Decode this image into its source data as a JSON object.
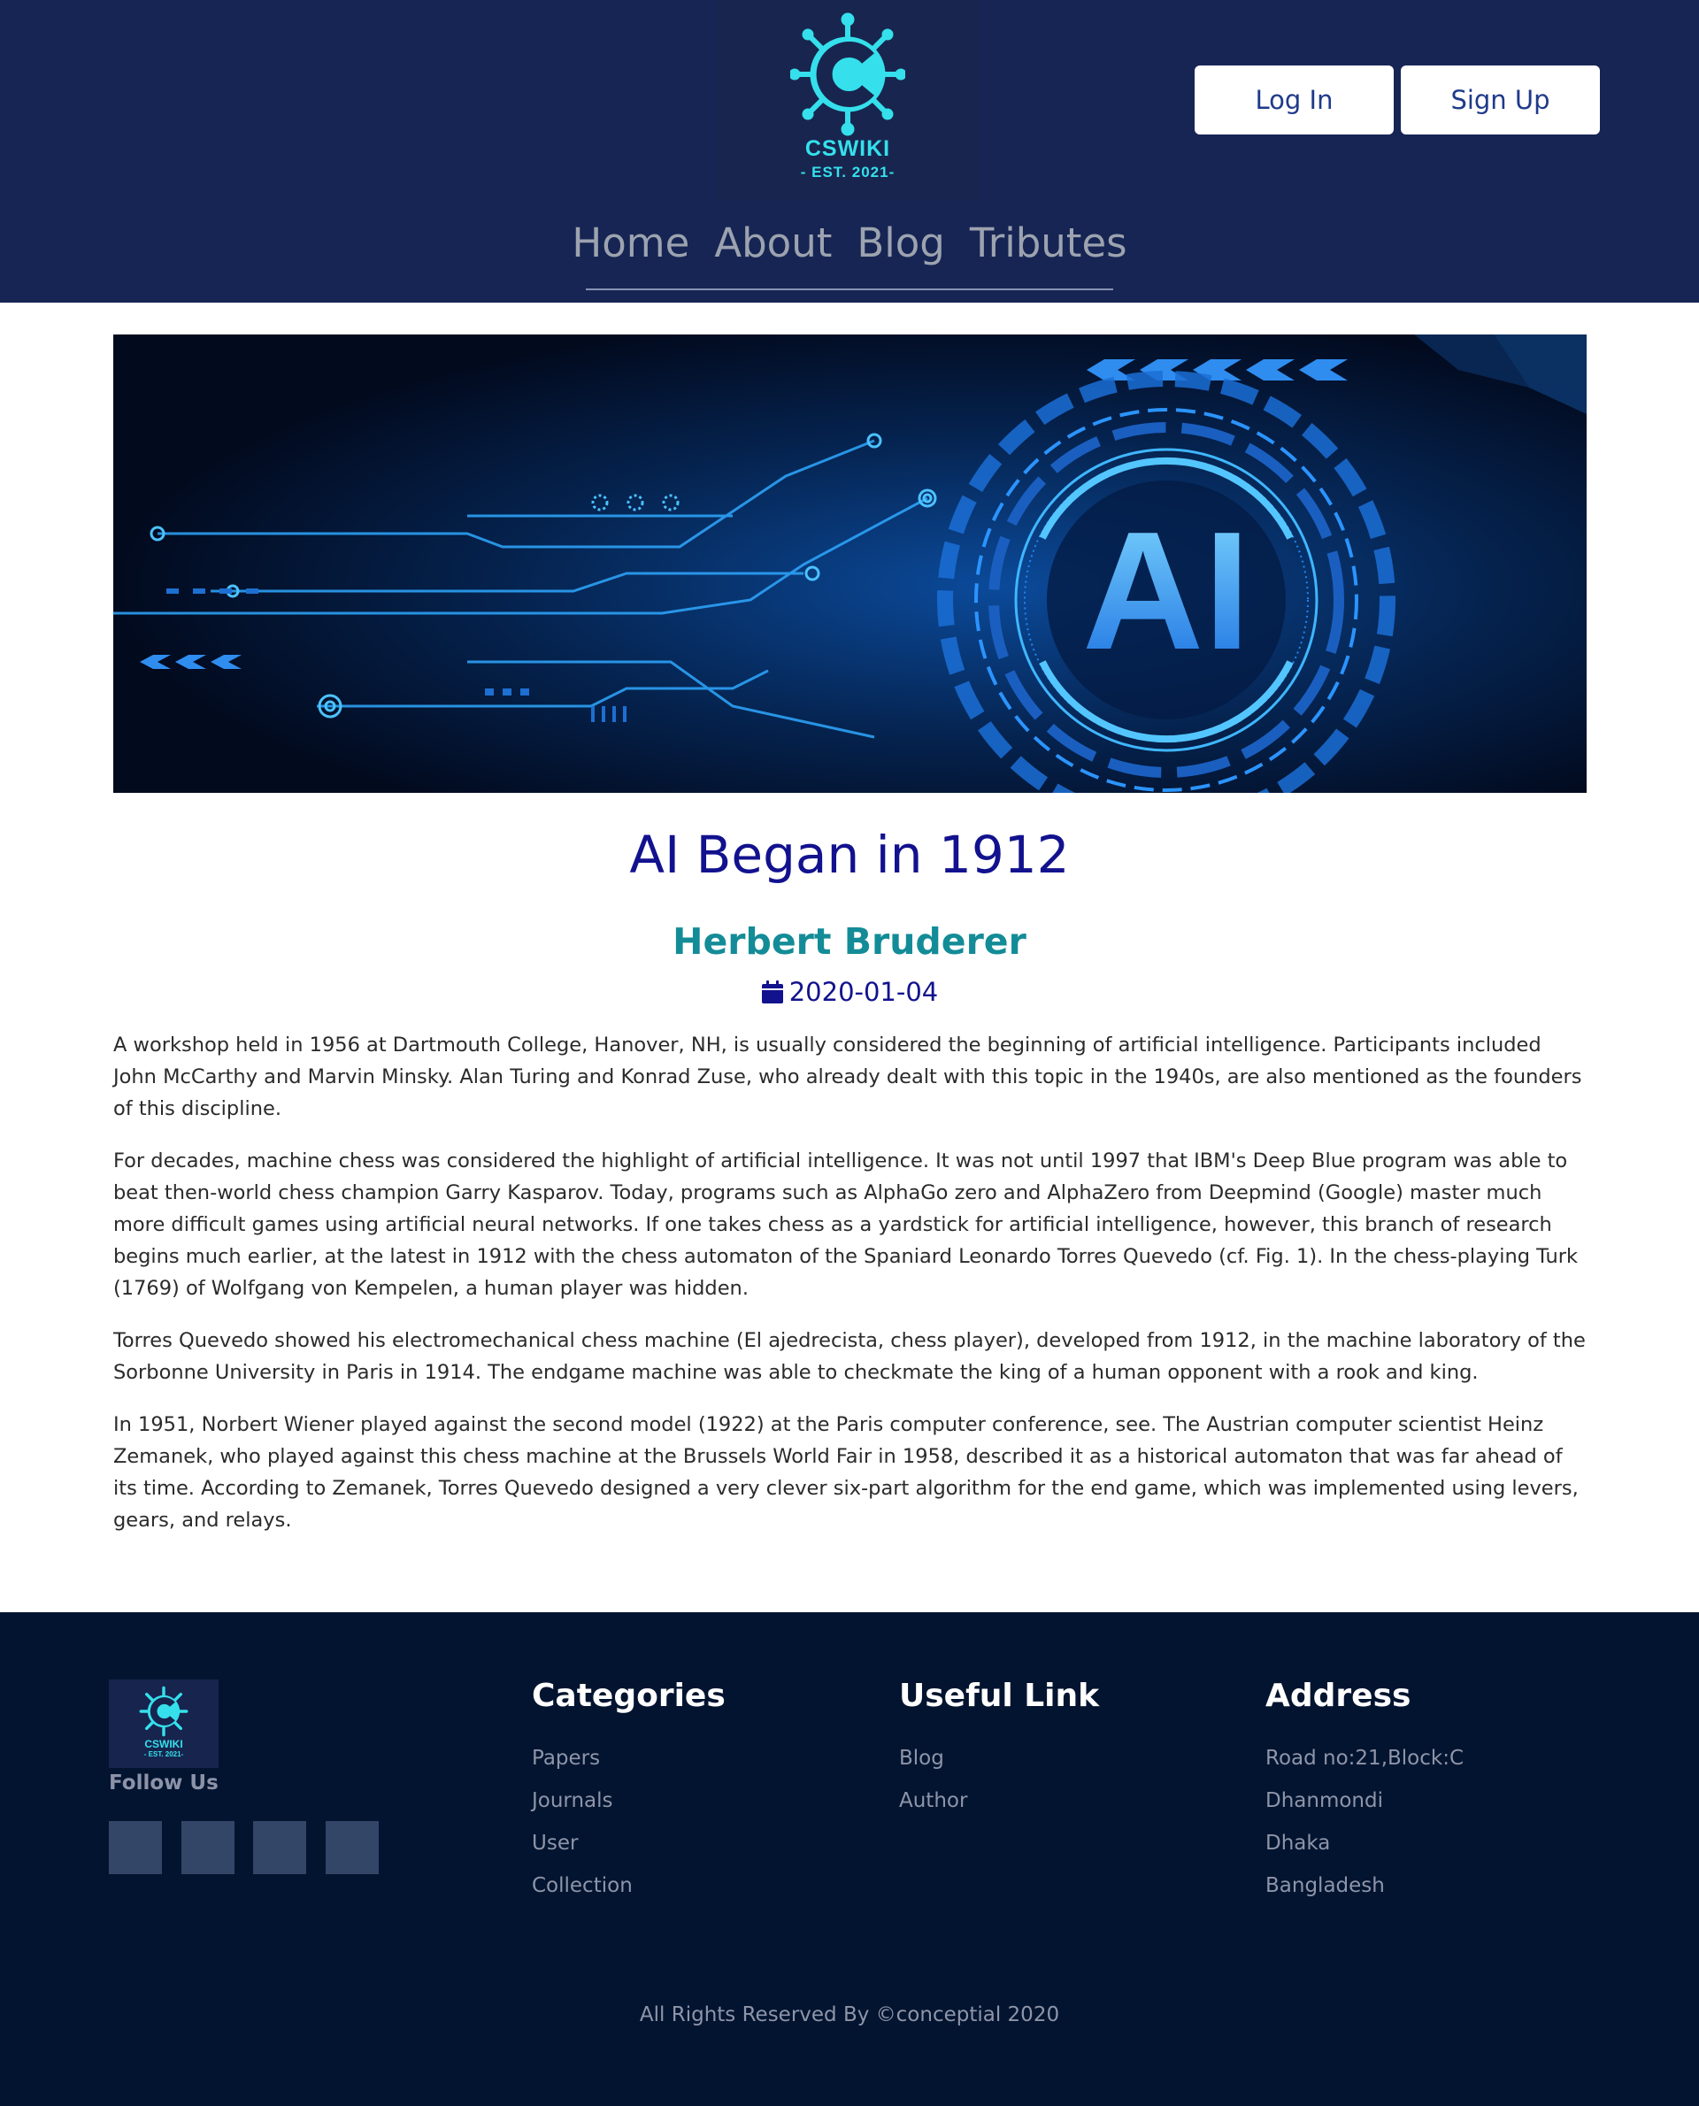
{
  "header": {
    "logo_title": "CSWIKI",
    "logo_subtitle": "- EST. 2021-",
    "login_label": "Log In",
    "signup_label": "Sign Up",
    "nav": [
      "Home",
      "About",
      "Blog",
      "Tributes"
    ]
  },
  "hero": {
    "icon": "ai-circuit-banner",
    "banner_text": "AI"
  },
  "article": {
    "title": "AI Began in 1912",
    "author": "Herbert Bruderer",
    "date": "2020-01-04",
    "paragraphs": [
      "A workshop held in 1956 at Dartmouth College, Hanover, NH, is usually considered the beginning of artificial intelligence. Participants included John McCarthy and Marvin Minsky. Alan Turing and Konrad Zuse, who already dealt with this topic in the 1940s, are also mentioned as the founders of this discipline.",
      "For decades, machine chess was considered the highlight of artificial intelligence. It was not until 1997 that IBM's Deep Blue program was able to beat then-world chess champion Garry Kasparov. Today, programs such as AlphaGo zero and AlphaZero from Deepmind (Google) master much more difficult games using artificial neural networks. If one takes chess as a yardstick for artificial intelligence, however, this branch of research begins much earlier, at the latest in 1912 with the chess automaton of the Spaniard Leonardo Torres Quevedo (cf. Fig. 1). In the chess-playing Turk (1769) of Wolfgang von Kempelen, a human player was hidden.",
      "Torres Quevedo showed his electromechanical chess machine (El ajedrecista, chess player), developed from 1912, in the machine laboratory of the Sorbonne University in Paris in 1914. The endgame machine was able to checkmate the king of a human opponent with a rook and king.",
      "In 1951, Norbert Wiener played against the second model (1922) at the Paris computer conference, see. The Austrian computer scientist Heinz Zemanek, who played against this chess machine at the Brussels World Fair in 1958, described it as a historical automaton that was far ahead of its time. According to Zemanek, Torres Quevedo designed a very clever six-part algorithm for the end game, which was implemented using levers, gears, and relays."
    ]
  },
  "footer": {
    "logo_title": "CSWIKI",
    "logo_subtitle": "- EST. 2021-",
    "follow_label": "Follow Us",
    "social_icons": [
      "social-icon-1",
      "social-icon-2",
      "social-icon-3",
      "social-icon-4"
    ],
    "categories": {
      "heading": "Categories",
      "items": [
        "Papers",
        "Journals",
        "User",
        "Collection"
      ]
    },
    "useful_links": {
      "heading": "Useful Link",
      "items": [
        "Blog",
        "Author"
      ]
    },
    "address": {
      "heading": "Address",
      "items": [
        "Road no:21,Block:C",
        "Dhanmondi",
        "Dhaka",
        "Bangladesh"
      ]
    },
    "copyright": "All Rights Reserved By ©conceptial 2020"
  },
  "colors": {
    "header_bg": "#172554",
    "footer_bg": "#031430",
    "title": "#12128f",
    "author": "#138c97",
    "logo_accent": "#35e0ec"
  }
}
